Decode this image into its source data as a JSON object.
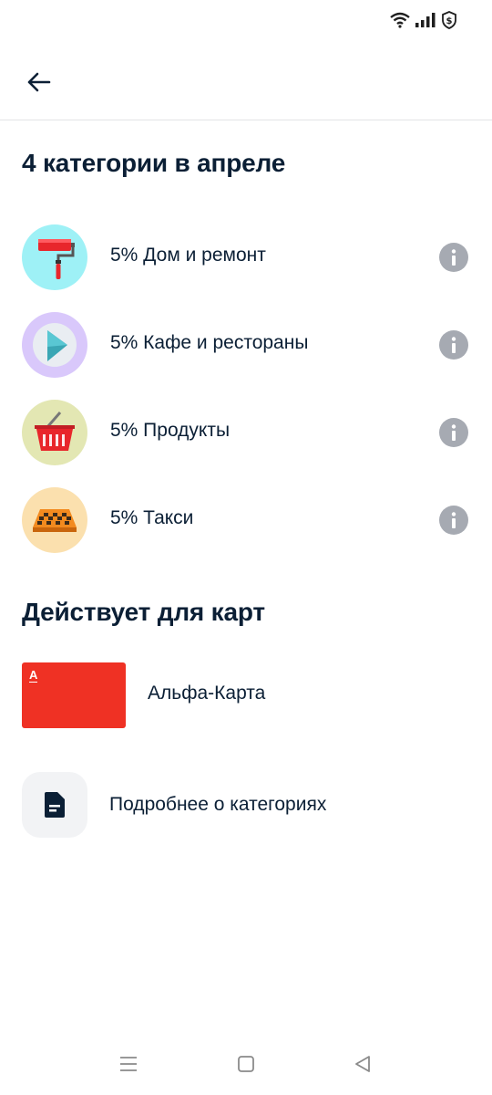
{
  "header": {
    "back_icon": "arrow-left-icon"
  },
  "status_bar": {
    "icons": [
      "wifi-icon",
      "signal-icon",
      "shield-dollar-icon"
    ]
  },
  "categories_section": {
    "title": "4 категории в апреле",
    "items": [
      {
        "label": "5% Дом и ремонт",
        "icon": "paint-roller-icon",
        "bg": "#9ef1f6"
      },
      {
        "label": "5% Кафе и рестораны",
        "icon": "play-bubble-icon",
        "bg": "#d9c8fb"
      },
      {
        "label": "5% Продукты",
        "icon": "shopping-basket-icon",
        "bg": "#e3e7b3"
      },
      {
        "label": "5% Такси",
        "icon": "taxi-sign-icon",
        "bg": "#fbe0ae"
      }
    ]
  },
  "cards_section": {
    "title": "Действует для карт",
    "card": {
      "label": "Альфа-Карта",
      "logo": "А",
      "color": "#ef3124"
    }
  },
  "more": {
    "label": "Подробнее о категориях",
    "icon": "document-icon"
  },
  "nav": {
    "icons": [
      "menu-icon",
      "home-icon",
      "back-triangle-icon"
    ]
  }
}
